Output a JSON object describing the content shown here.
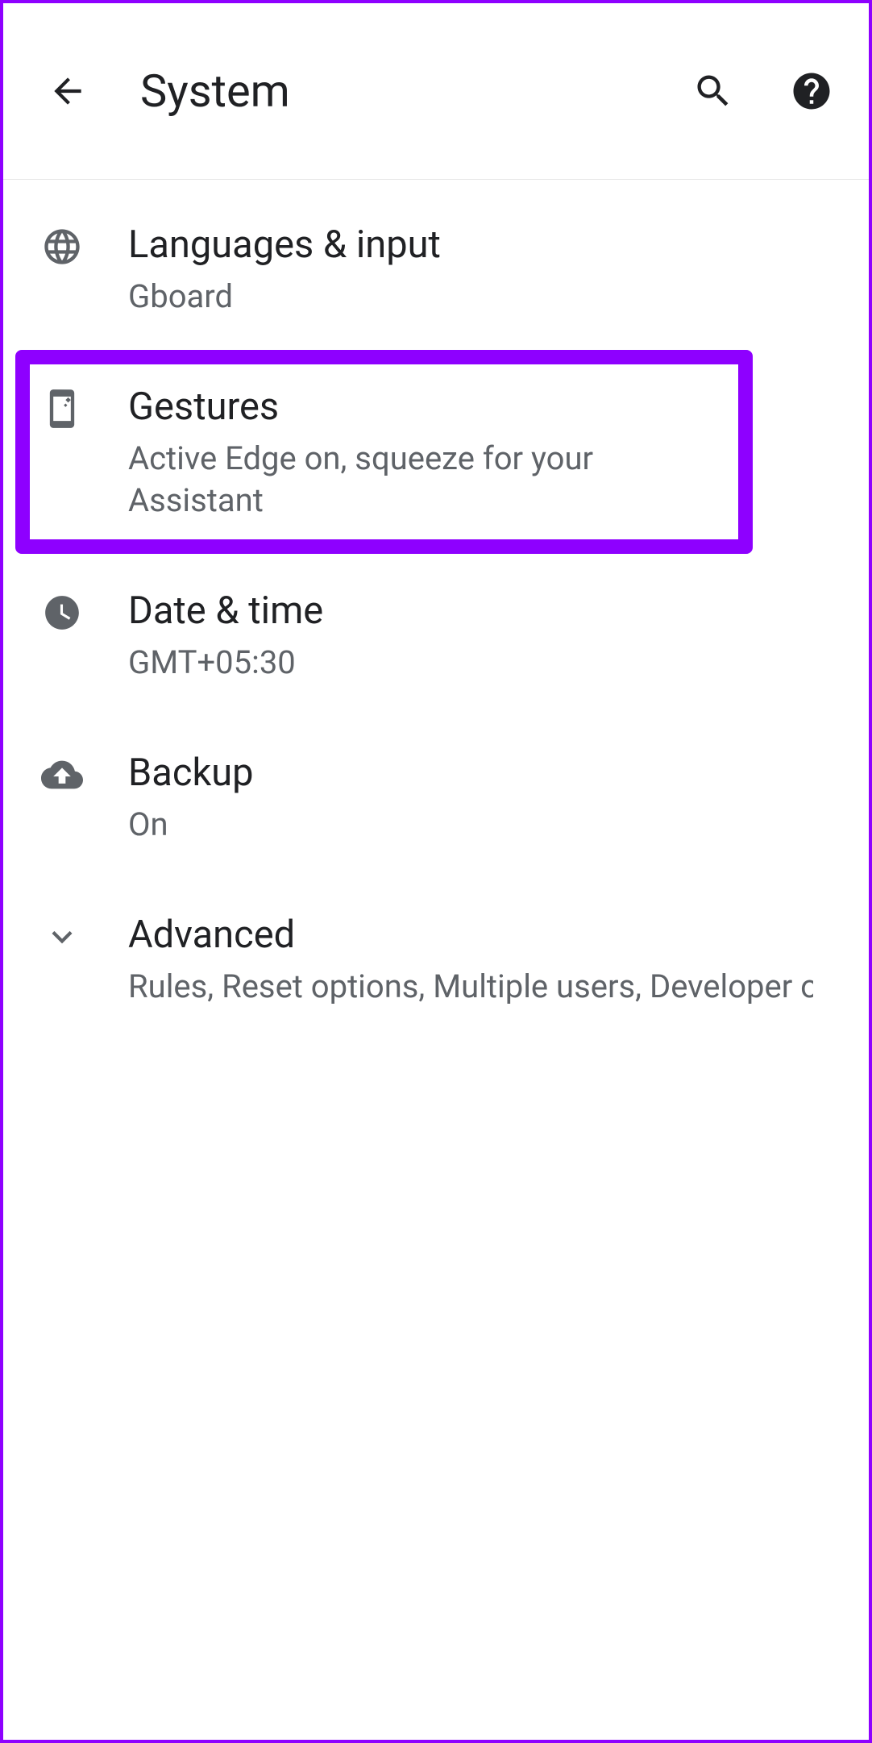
{
  "header": {
    "title": "System"
  },
  "items": [
    {
      "title": "Languages & input",
      "subtitle": "Gboard"
    },
    {
      "title": "Gestures",
      "subtitle": "Active Edge on, squeeze for your Assistant"
    },
    {
      "title": "Date & time",
      "subtitle": "GMT+05:30"
    },
    {
      "title": "Backup",
      "subtitle": "On"
    },
    {
      "title": "Advanced",
      "subtitle": "Rules, Reset options, Multiple users, Developer opti.."
    }
  ]
}
